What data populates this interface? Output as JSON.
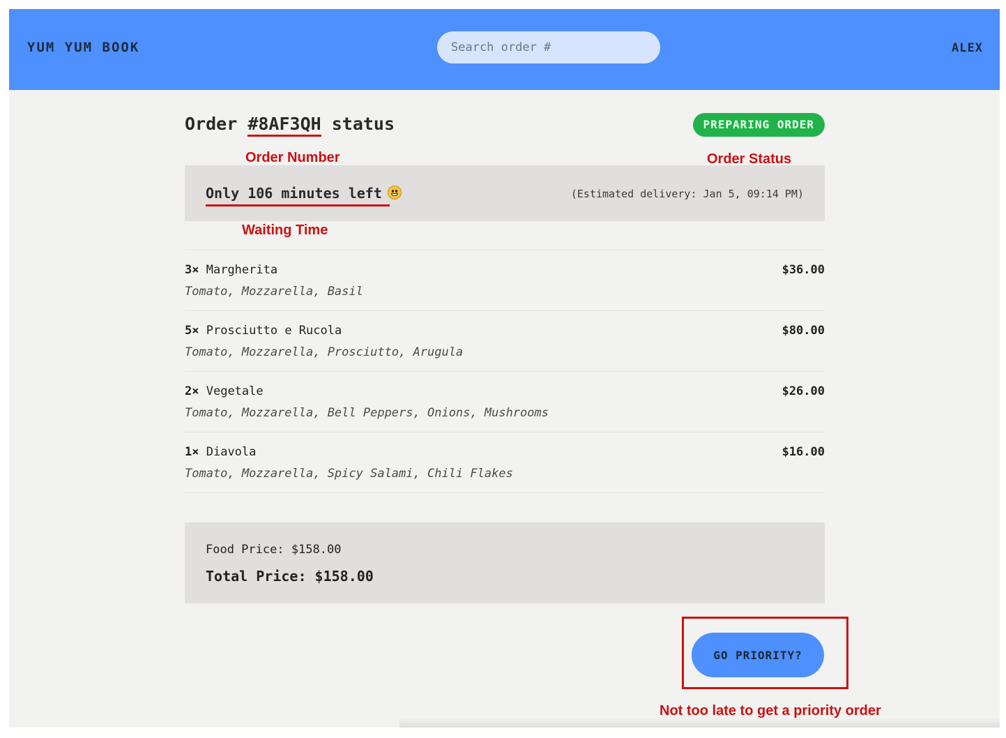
{
  "header": {
    "logo": "YUM YUM BOOK",
    "search_placeholder": "Search order #",
    "user": "ALEX"
  },
  "order": {
    "title_prefix": "Order ",
    "id": "#8AF3QH",
    "title_suffix": " status",
    "status": "PREPARING ORDER",
    "wait_text": "Only 106 minutes left",
    "eta": "(Estimated delivery: Jan 5, 09:14 PM)"
  },
  "items": [
    {
      "qty": "3×",
      "name": "Margherita",
      "ingredients": "Tomato, Mozzarella, Basil",
      "price": "$36.00"
    },
    {
      "qty": "5×",
      "name": "Prosciutto e Rucola",
      "ingredients": "Tomato, Mozzarella, Prosciutto, Arugula",
      "price": "$80.00"
    },
    {
      "qty": "2×",
      "name": "Vegetale",
      "ingredients": "Tomato, Mozzarella, Bell Peppers, Onions, Mushrooms",
      "price": "$26.00"
    },
    {
      "qty": "1×",
      "name": "Diavola",
      "ingredients": "Tomato, Mozzarella, Spicy Salami, Chili Flakes",
      "price": "$16.00"
    }
  ],
  "summary": {
    "food_price": "Food Price: $158.00",
    "total_price": "Total Price: $158.00"
  },
  "priority_button": "GO PRIORITY?",
  "annotations": {
    "order_number": "Order Number",
    "order_status": "Order Status",
    "waiting_time": "Waiting Time",
    "priority": "Not too late to get a priority order"
  },
  "colors": {
    "header_bg": "#4d90fe",
    "status_badge": "#22b24c",
    "annotation_red": "#cc1111",
    "page_bg": "#f2f2f0",
    "panel_bg": "#e0dfdd"
  },
  "icons": {
    "wait_emoji": "grinning-face-icon"
  }
}
